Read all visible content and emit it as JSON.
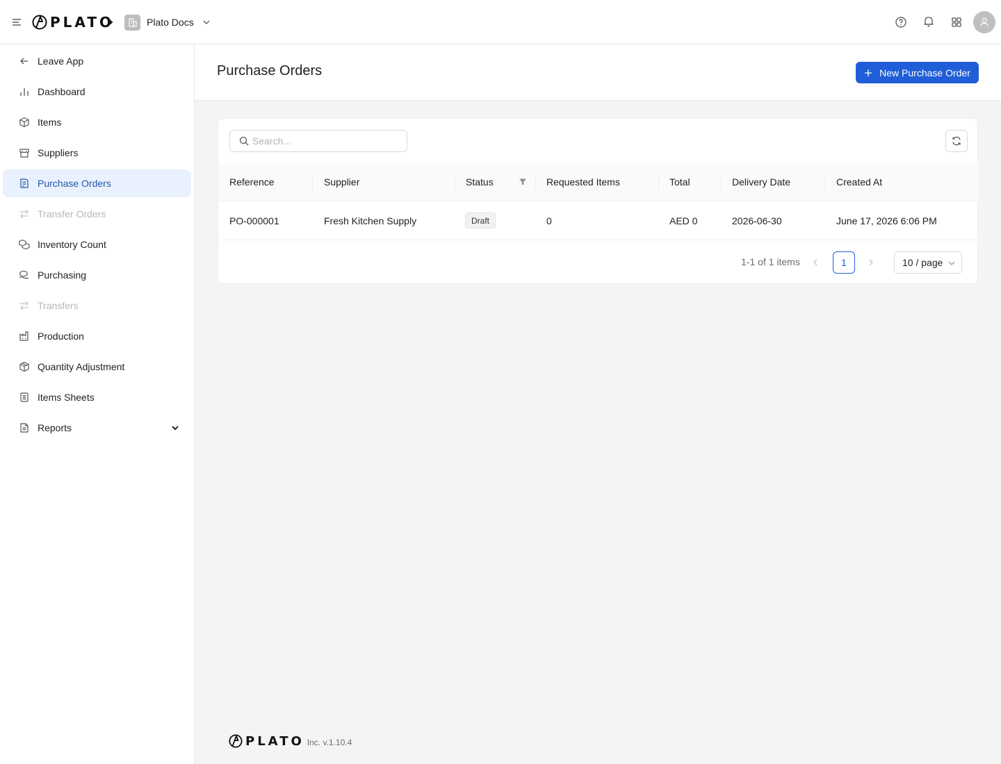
{
  "header": {
    "logo_text": "PLATO",
    "workspace_name": "Plato Docs"
  },
  "sidebar": {
    "items": [
      {
        "label": "Leave App",
        "icon": "arrow-left-icon",
        "state": "normal"
      },
      {
        "label": "Dashboard",
        "icon": "bar-chart-icon",
        "state": "normal"
      },
      {
        "label": "Items",
        "icon": "box-icon",
        "state": "normal"
      },
      {
        "label": "Suppliers",
        "icon": "store-icon",
        "state": "normal"
      },
      {
        "label": "Purchase Orders",
        "icon": "order-doc-icon",
        "state": "active"
      },
      {
        "label": "Transfer Orders",
        "icon": "transfer-icon",
        "state": "disabled"
      },
      {
        "label": "Inventory Count",
        "icon": "boxes-icon",
        "state": "normal"
      },
      {
        "label": "Purchasing",
        "icon": "hand-box-icon",
        "state": "normal"
      },
      {
        "label": "Transfers",
        "icon": "transfer-icon",
        "state": "disabled"
      },
      {
        "label": "Production",
        "icon": "factory-icon",
        "state": "normal"
      },
      {
        "label": "Quantity Adjustment",
        "icon": "box-adjust-icon",
        "state": "normal"
      },
      {
        "label": "Items Sheets",
        "icon": "sheet-icon",
        "state": "normal"
      },
      {
        "label": "Reports",
        "icon": "report-icon",
        "state": "normal"
      }
    ]
  },
  "page": {
    "title": "Purchase Orders",
    "new_button_label": "New Purchase Order"
  },
  "search": {
    "placeholder": "Search..."
  },
  "table": {
    "columns": [
      "Reference",
      "Supplier",
      "Status",
      "Requested Items",
      "Total",
      "Delivery Date",
      "Created At"
    ],
    "rows": [
      {
        "reference": "PO-000001",
        "supplier": "Fresh Kitchen Supply",
        "status": "Draft",
        "requested_items": "0",
        "total": "AED 0",
        "delivery_date": "2026-06-30",
        "created_at": "June 17, 2026 6:06 PM"
      }
    ]
  },
  "pagination": {
    "total_text": "1-1 of 1 items",
    "current_page": "1",
    "page_size": "10 / page"
  },
  "footer": {
    "logo_text": "PLATO",
    "version": "Inc. v.1.10.4"
  },
  "colors": {
    "primary": "#1f5ed8",
    "active_nav_bg": "#e8f1fd",
    "active_nav_text": "#2557a7",
    "page_bg": "#f4f4f5"
  }
}
